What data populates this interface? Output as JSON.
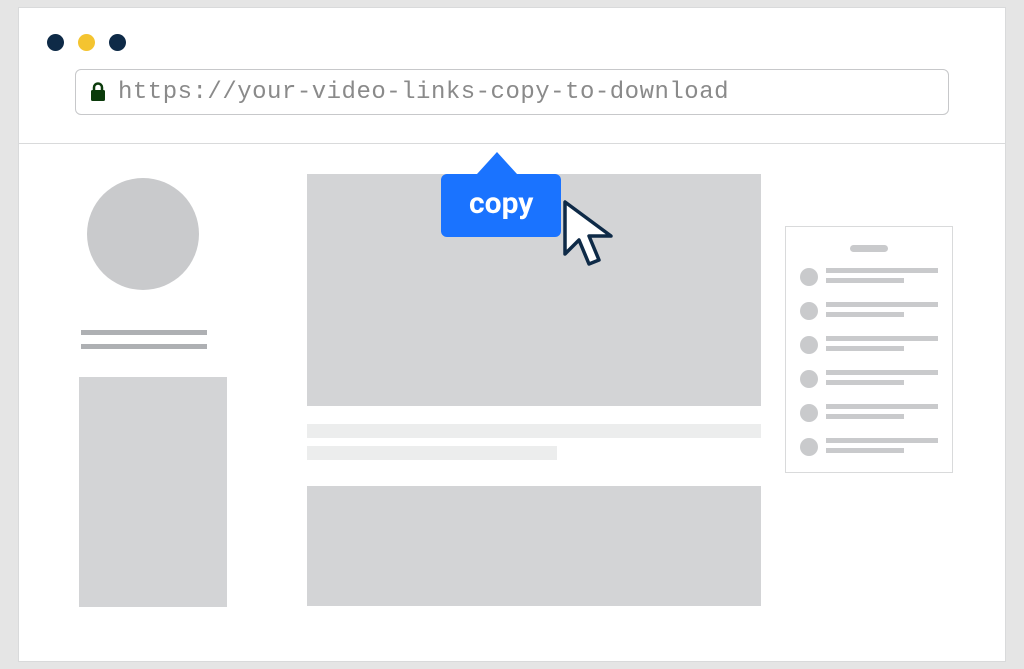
{
  "window": {
    "traffic_dots": [
      "navy",
      "yellow",
      "navy"
    ]
  },
  "address_bar": {
    "lock_icon": "lock-icon",
    "url": "https://your-video-links-copy-to-download"
  },
  "tooltip": {
    "label": "copy",
    "accent_color": "#1a73ff"
  },
  "left_panel": {
    "avatar": "avatar-placeholder",
    "lines": 2,
    "thumbnail": "thumbnail-placeholder"
  },
  "main_panel": {
    "video_placeholder": "video-rect",
    "description_lines": 2,
    "video_placeholder_2": "video-rect-2"
  },
  "right_panel": {
    "header": "list-header",
    "item_count": 6
  },
  "cursor": "arrow-cursor"
}
